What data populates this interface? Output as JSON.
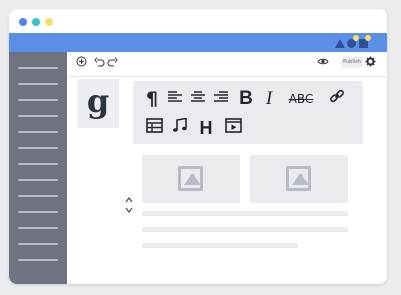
{
  "window": {
    "dots": [
      "#4f83e6",
      "#39c2c9",
      "#f2e165"
    ],
    "accent_color": "#5b8ee6"
  },
  "topbar": {
    "icons": [
      "add-circle-icon",
      "undo-icon",
      "redo-icon",
      "eye-icon",
      "gear-icon"
    ],
    "publish_label": "Publish"
  },
  "logo": {
    "letter": "g"
  },
  "toolbar": {
    "tools": [
      {
        "name": "paragraph",
        "glyph": "¶"
      },
      {
        "name": "align-left",
        "glyph": "≡"
      },
      {
        "name": "align-center",
        "glyph": "≡"
      },
      {
        "name": "align-right",
        "glyph": "≡"
      },
      {
        "name": "bold",
        "glyph": "B"
      },
      {
        "name": "italic",
        "glyph": "I"
      },
      {
        "name": "strikethrough",
        "glyph": "ABC"
      },
      {
        "name": "link",
        "glyph": "🔗"
      },
      {
        "name": "table",
        "glyph": "▦"
      },
      {
        "name": "music",
        "glyph": "♫"
      },
      {
        "name": "heading",
        "glyph": "H"
      },
      {
        "name": "video",
        "glyph": "▶"
      }
    ]
  },
  "content": {
    "images": [
      "image-placeholder-1",
      "image-placeholder-2"
    ],
    "move_control": "↕"
  }
}
